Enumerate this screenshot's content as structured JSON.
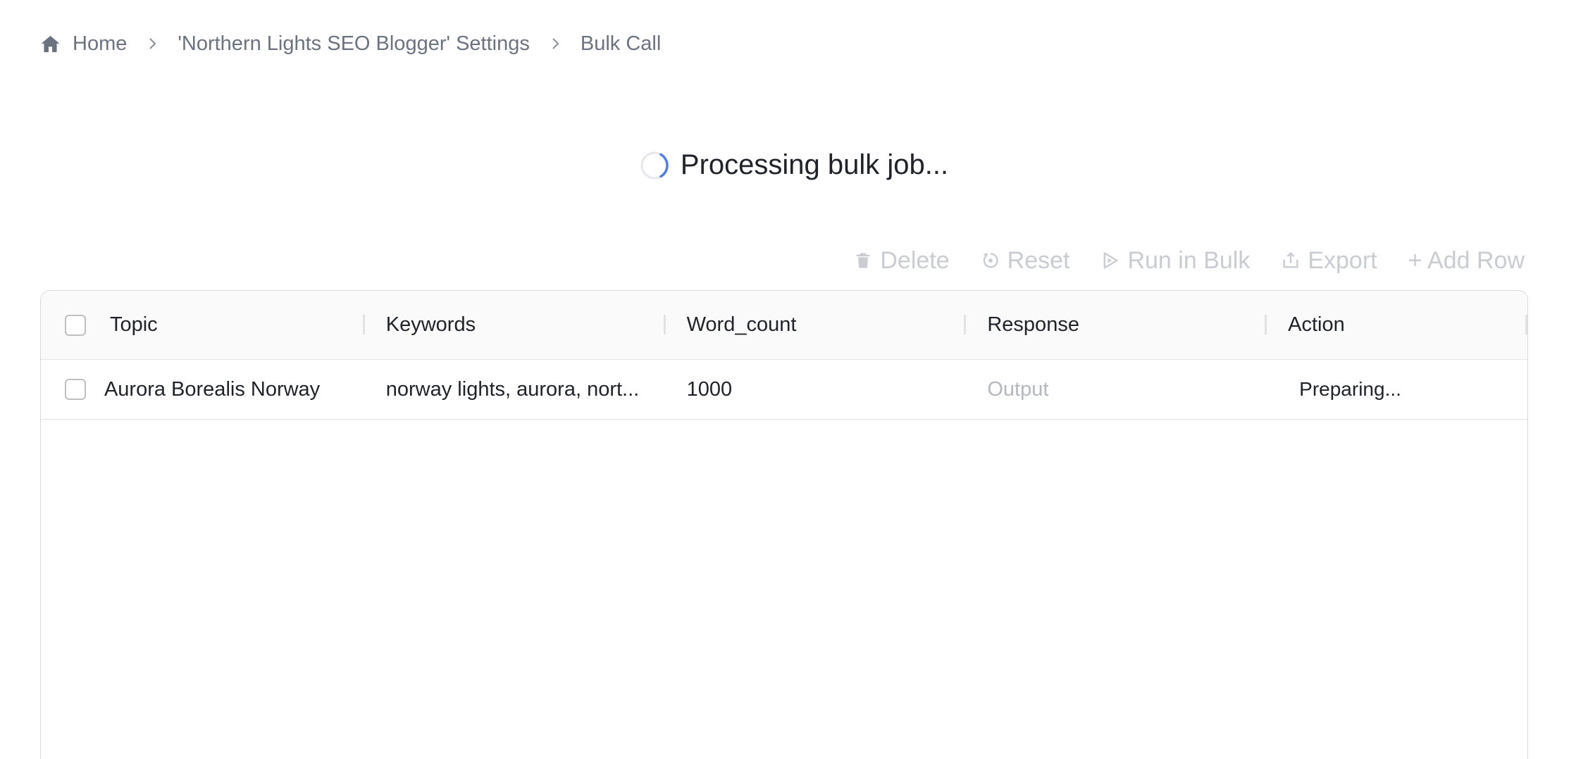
{
  "breadcrumb": {
    "home": "Home",
    "settings": "'Northern Lights SEO Blogger' Settings",
    "current": "Bulk Call"
  },
  "status": {
    "message": "Processing bulk job..."
  },
  "toolbar": {
    "delete": "Delete",
    "reset": "Reset",
    "run": "Run in Bulk",
    "export": "Export",
    "add_row": "+ Add Row"
  },
  "table": {
    "columns": [
      "Topic",
      "Keywords",
      "Word_count",
      "Response",
      "Action"
    ],
    "rows": [
      {
        "topic": "Aurora Borealis Norway",
        "keywords": "norway lights, aurora, nort...",
        "word_count": "1000",
        "response": "Output",
        "action": "Preparing..."
      }
    ]
  },
  "colors": {
    "spinner_accent": "#4f7fe6",
    "disabled_text": "#c9ccd1",
    "muted_text": "#6b7280"
  }
}
